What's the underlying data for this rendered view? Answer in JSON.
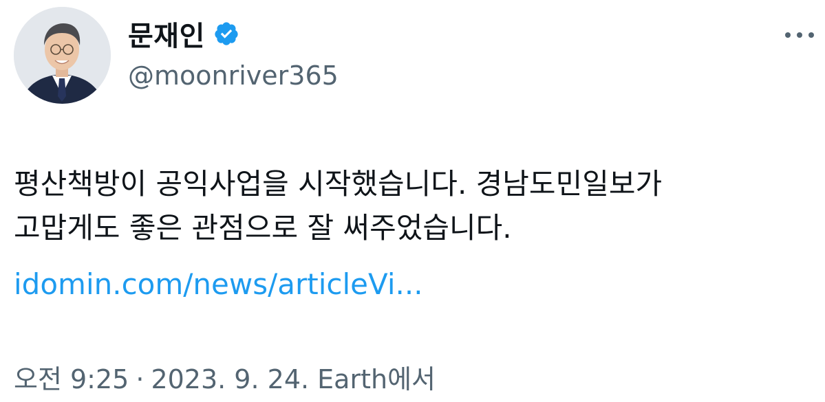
{
  "author": {
    "name": "문재인",
    "handle": "@moonriver365",
    "verified": true
  },
  "tweet": {
    "text_lines": [
      "평산책방이 공익사업을 시작했습니다. 경남도민일보가",
      "고맙게도 좋은 관점으로 잘 써주었습니다."
    ],
    "link_text": "idomin.com/news/articleVi..."
  },
  "meta": {
    "time": "오전 9:25",
    "separator": "·",
    "date": "2023. 9. 24.",
    "source": "Earth에서"
  },
  "icons": {
    "verified": "verified-badge-icon",
    "more": "more-horizontal-icon"
  },
  "colors": {
    "text_primary": "#0f1419",
    "text_secondary": "#536471",
    "link": "#1d9bf0",
    "verified_badge": "#1d9bf0"
  }
}
